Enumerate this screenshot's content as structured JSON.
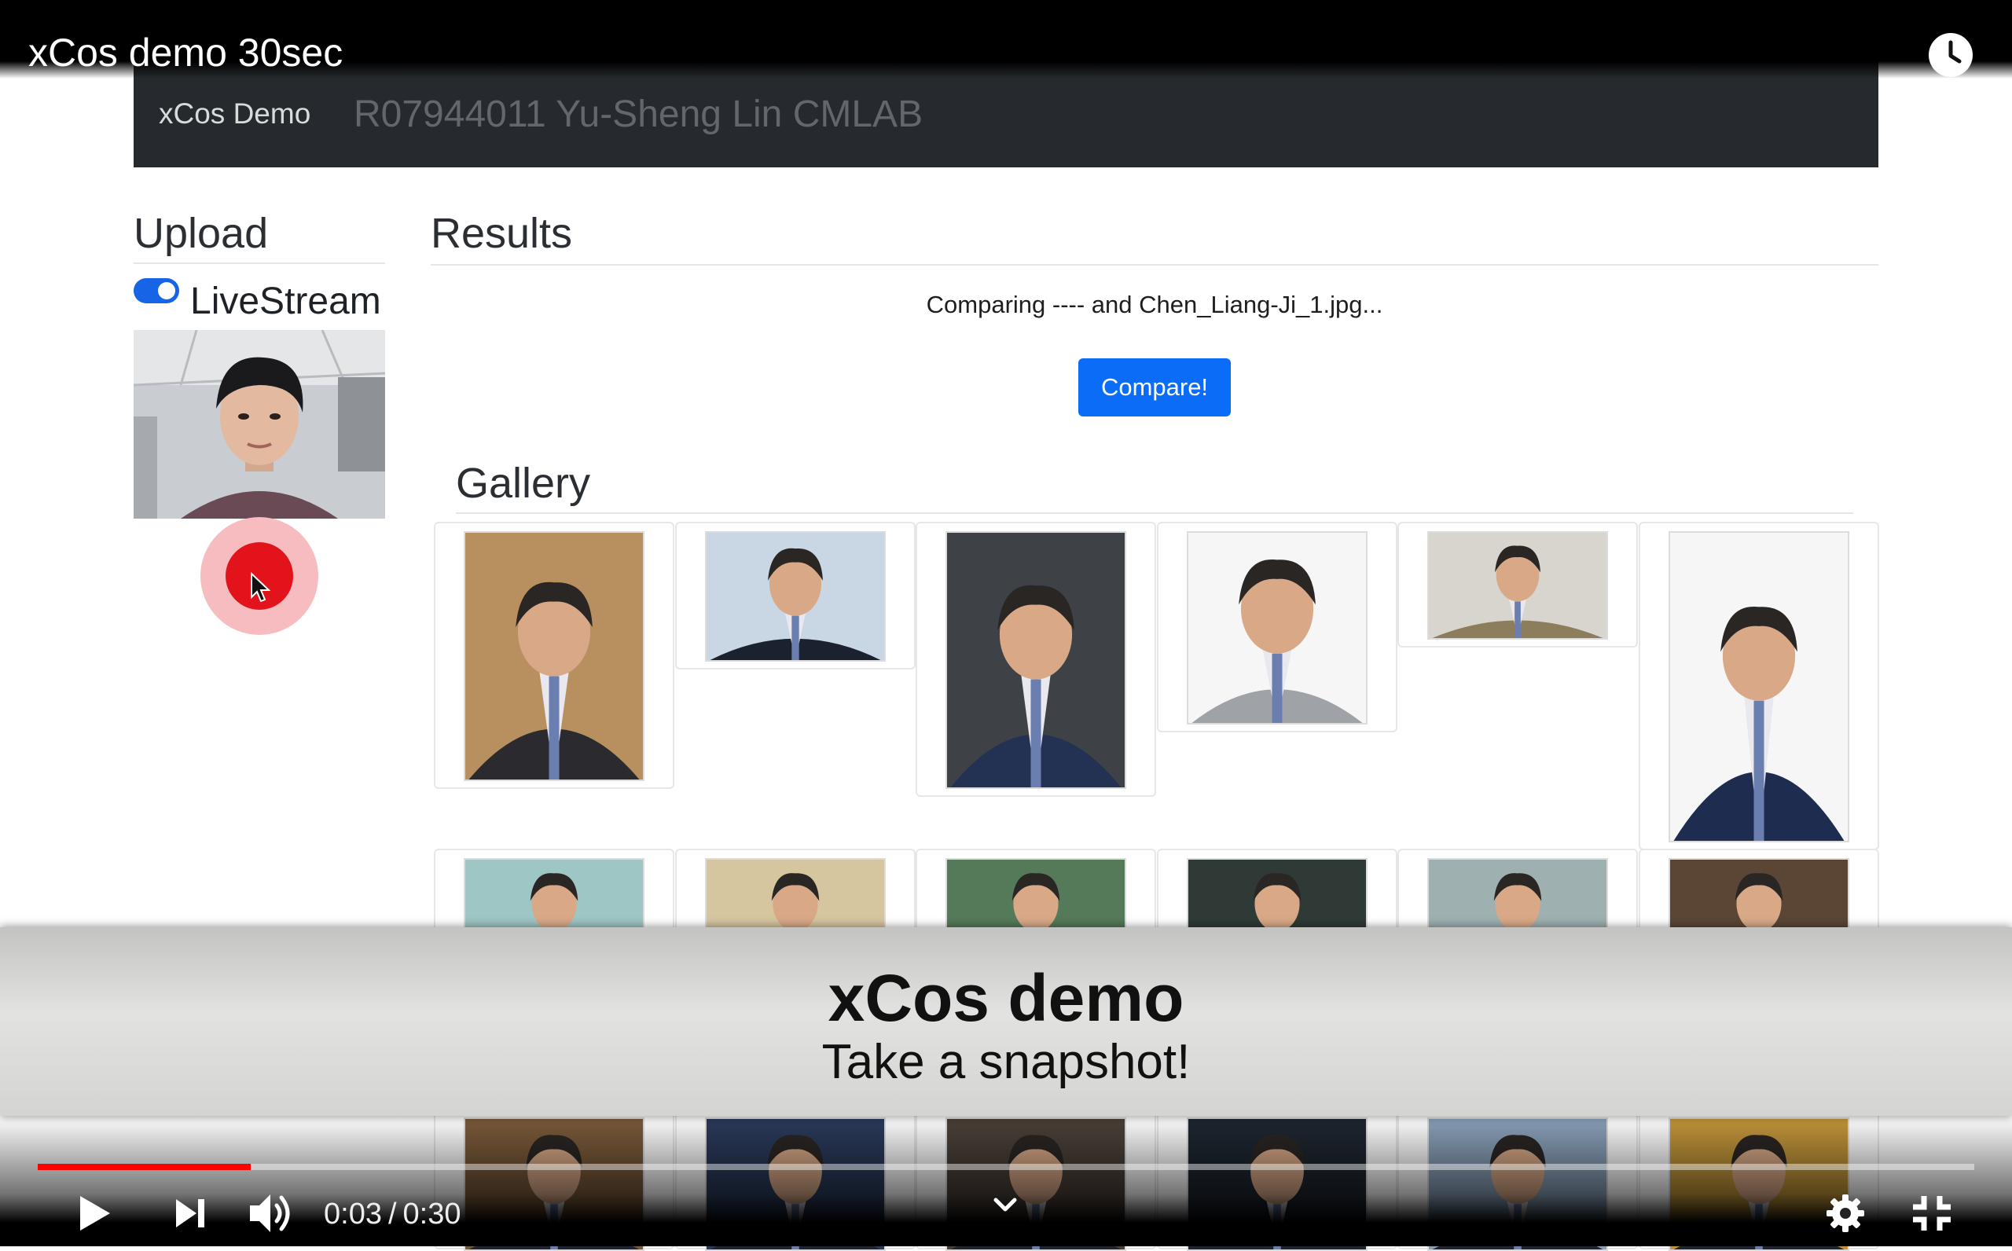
{
  "player": {
    "title": "xCos demo 30sec",
    "current_time": "0:03",
    "duration": "0:30",
    "progress": 0.11,
    "accent_color": "#ff0000",
    "icons": [
      "play-icon",
      "next-icon",
      "volume-icon",
      "chevron-down-icon",
      "settings-gear-icon",
      "exit-fullscreen-icon",
      "watch-later-clock-icon"
    ]
  },
  "web_page": {
    "navbar": {
      "brand": "xCos Demo",
      "author": "R07944011 Yu-Sheng Lin CMLAB"
    },
    "upload": {
      "title": "Upload",
      "livestream_label": "LiveStream",
      "livestream_on": true
    },
    "results": {
      "title": "Results",
      "status": "Comparing ---- and Chen_Liang-Ji_1.jpg...",
      "compare_button": "Compare!",
      "accent_color": "#0b6cf7"
    },
    "gallery": {
      "title": "Gallery",
      "visible_rows": 3,
      "visible_columns": 6
    }
  },
  "caption": {
    "title": "xCos demo",
    "subtitle": "Take a snapshot!"
  }
}
